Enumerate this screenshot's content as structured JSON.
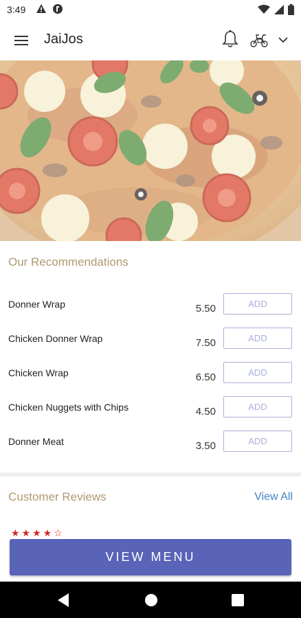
{
  "status_bar": {
    "time": "3:49"
  },
  "app_bar": {
    "title": "JaiJos"
  },
  "recommendations": {
    "title": "Our Recommendations",
    "add_label": "ADD",
    "items": [
      {
        "name": "Donner Wrap",
        "price": "5.50"
      },
      {
        "name": "Chicken Donner Wrap",
        "price": "7.50"
      },
      {
        "name": "Chicken Wrap",
        "price": "6.50"
      },
      {
        "name": "Chicken Nuggets with Chips",
        "price": "4.50"
      },
      {
        "name": "Donner Meat",
        "price": "3.50"
      }
    ]
  },
  "reviews": {
    "title": "Customer Reviews",
    "view_all": "View All"
  },
  "view_menu": {
    "label": "VIEW MENU"
  },
  "colors": {
    "accent": "#5963b8",
    "section_title": "#b09872",
    "link": "#3f82c2",
    "star": "#d62424"
  }
}
